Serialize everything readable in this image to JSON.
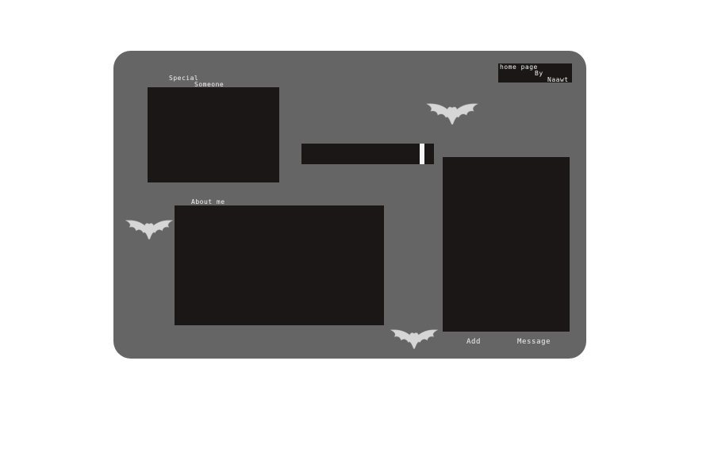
{
  "header": {
    "title_line1": "home page",
    "title_line2": "By",
    "title_line3": "Naawt"
  },
  "special_section": {
    "label_line1": "Special",
    "label_line2": "Someone"
  },
  "about_section": {
    "label": "About me"
  },
  "footer_links": {
    "add": "Add",
    "message": "Message"
  },
  "colors": {
    "page_background": "#ffffff",
    "panel": "#666566",
    "content_box": "#1a1716",
    "text": "#f2f2f2",
    "bat": "#d6d6d6"
  },
  "icons": {
    "decoration": "bat-icon"
  }
}
